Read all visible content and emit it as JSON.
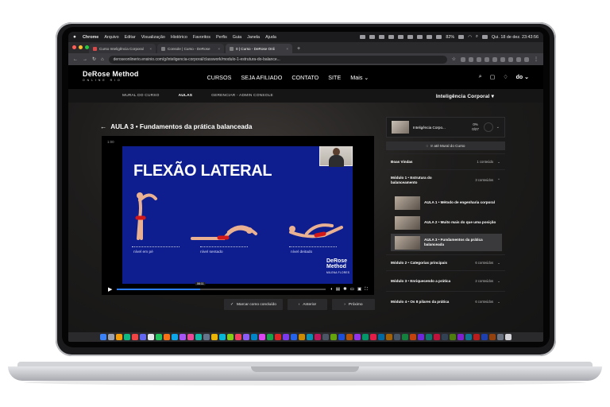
{
  "menubar": {
    "app": "Chrome",
    "items": [
      "Arquivo",
      "Editar",
      "Visualização",
      "Histórico",
      "Favoritos",
      "Perfis",
      "Guia",
      "Janela",
      "Ajuda"
    ],
    "battery": "82%",
    "clock": "Qui. 18 de dez. 23:43:56"
  },
  "browser": {
    "tabs": [
      {
        "label": "Curso Inteligência Corporal",
        "active": false
      },
      {
        "label": "Console | Curso - DeRose",
        "active": false
      },
      {
        "label": "0 | Curso - DeRose Onli",
        "active": true
      }
    ],
    "new_tab": "+",
    "url": "deroseonlinerio.ensinio.com/g/inteligencia-corporal/classwork/modulo-1-estrutura-do-balance..."
  },
  "site": {
    "logo_main": "DeRose Method",
    "logo_sub": "ONLINE  RIO",
    "nav": [
      "CURSOS",
      "SEJA AFILIADO",
      "CONTATO",
      "SITE",
      "Mais ⌄"
    ],
    "avatar": "do ⌄"
  },
  "subnav": {
    "items": [
      "MURAL DO CURSO",
      "AULAS",
      "GERENCIAR - ADMIN CONSOLE"
    ],
    "active": "AULAS",
    "course": "Inteligência Corporal"
  },
  "lesson": {
    "title": "AULA 3 • Fundamentos da prática balanceada",
    "back": "←"
  },
  "video": {
    "time_top": "1:00",
    "slide_title": "FLEXÃO LATERAL",
    "pose_labels": [
      "nível em pé",
      "nível sentado",
      "nível deitado"
    ],
    "brand_line1": "DeRose",
    "brand_line2": "Method",
    "brand_small": "MILENA FLORES",
    "tooltip": "08:11",
    "progress": 0.4
  },
  "actions": {
    "complete": "Marcar como concluído",
    "prev": "Anterior",
    "next": "Próximo"
  },
  "panel": {
    "course_title": "Inteligência Corpo...",
    "percent": "0%",
    "count": "0/27",
    "mural": "Ir até Mural do Curso",
    "modules": [
      {
        "name": "Boas Vindas",
        "count": "1 conteúdo",
        "chev": "⌄"
      },
      {
        "name": "Módulo 1 • Estrutura do balanceamento",
        "count": "3 conteúdos",
        "chev": "⌃"
      },
      {
        "name": "Módulo 2 • Categorias principais",
        "count": "6 conteúdos",
        "chev": "⌄"
      },
      {
        "name": "Módulo 3 • Enriquecendo a prática",
        "count": "2 conteúdos",
        "chev": "⌄"
      },
      {
        "name": "Módulo 4 • Os 8 pilares da prática",
        "count": "6 conteúdos",
        "chev": "⌄"
      }
    ],
    "lessons": [
      {
        "name": "AULA 1 • Método de engenharia corporal"
      },
      {
        "name": "AULA 2 • Muito mais do que uma posição"
      },
      {
        "name": "AULA 3 • Fundamentos da prática balanceada"
      }
    ]
  },
  "colors": {
    "slide_bg": "#0e1e8f",
    "progress": "#2d7cf0",
    "page_bg": "#141414"
  }
}
